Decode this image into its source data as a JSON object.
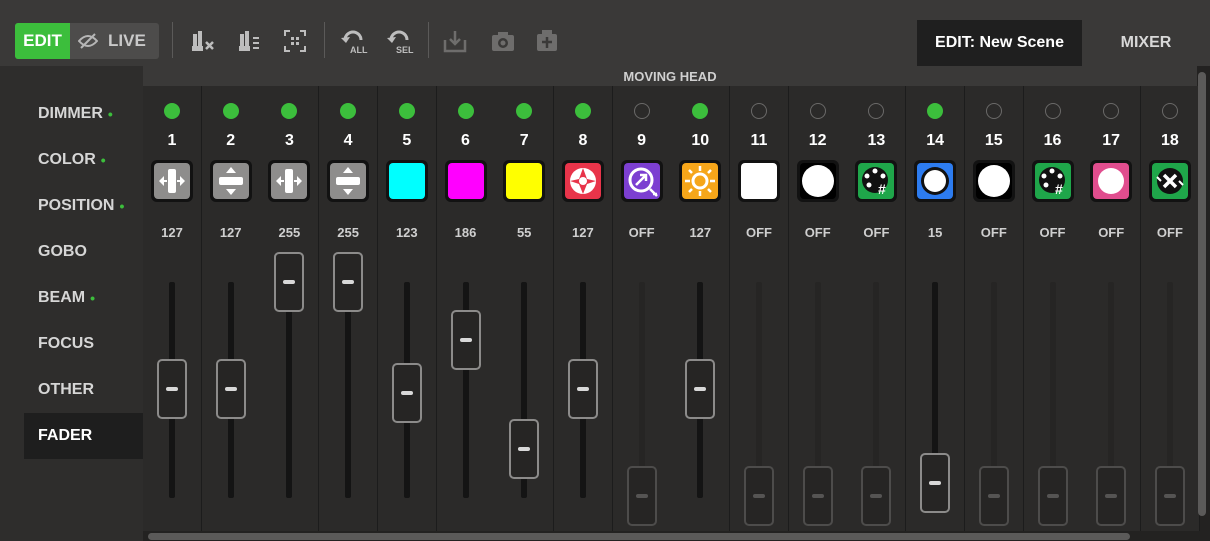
{
  "toolbar": {
    "edit_label": "EDIT",
    "live_label": "LIVE",
    "icons": [
      "clear-selection-icon",
      "highlight-icon",
      "select-group-icon",
      "reset-all-icon",
      "reset-selected-icon",
      "import-icon",
      "snapshot-icon",
      "palette-icon"
    ],
    "reset_all_label": "ALL",
    "reset_sel_label": "SEL"
  },
  "tabs": {
    "edit_scene": "EDIT: New Scene",
    "mixer": "MIXER"
  },
  "sidebar": {
    "items": [
      {
        "label": "DIMMER",
        "dot": "•"
      },
      {
        "label": "COLOR",
        "dot": "•"
      },
      {
        "label": "POSITION",
        "dot": "•"
      },
      {
        "label": "GOBO",
        "dot": ""
      },
      {
        "label": "BEAM",
        "dot": "•"
      },
      {
        "label": "FOCUS",
        "dot": ""
      },
      {
        "label": "OTHER",
        "dot": ""
      },
      {
        "label": "FADER",
        "dot": ""
      }
    ],
    "active": "FADER"
  },
  "group_header": "MOVING HEAD",
  "channels": [
    {
      "num": "1",
      "value": "127",
      "led": "on",
      "level": 0.5,
      "icon": "pan-fine-icon"
    },
    {
      "num": "2",
      "value": "127",
      "led": "on",
      "level": 0.5,
      "icon": "tilt-icon"
    },
    {
      "num": "3",
      "value": "255",
      "led": "on",
      "level": 1.0,
      "icon": "pan-icon"
    },
    {
      "num": "4",
      "value": "255",
      "led": "on",
      "level": 1.0,
      "icon": "tilt-fine-icon"
    },
    {
      "num": "5",
      "value": "123",
      "led": "on",
      "level": 0.48,
      "icon": "cyan-swatch-icon"
    },
    {
      "num": "6",
      "value": "186",
      "led": "on",
      "level": 0.73,
      "icon": "magenta-swatch-icon"
    },
    {
      "num": "7",
      "value": "55",
      "led": "on",
      "level": 0.22,
      "icon": "yellow-swatch-icon"
    },
    {
      "num": "8",
      "value": "127",
      "led": "on",
      "level": 0.5,
      "icon": "shutter-icon"
    },
    {
      "num": "9",
      "value": "OFF",
      "led": "off",
      "level": 0.0,
      "icon": "zoom-icon"
    },
    {
      "num": "10",
      "value": "127",
      "led": "on",
      "level": 0.5,
      "icon": "dimmer-sun-icon"
    },
    {
      "num": "11",
      "value": "OFF",
      "led": "off",
      "level": 0.0,
      "icon": "white-swatch-icon"
    },
    {
      "num": "12",
      "value": "OFF",
      "led": "off",
      "level": 0.0,
      "icon": "white-circle-icon"
    },
    {
      "num": "13",
      "value": "OFF",
      "led": "off",
      "level": 0.0,
      "icon": "gobo-wheel-icon"
    },
    {
      "num": "14",
      "value": "15",
      "led": "on",
      "level": 0.06,
      "icon": "color-wheel-icon"
    },
    {
      "num": "15",
      "value": "OFF",
      "led": "off",
      "level": 0.0,
      "icon": "white-circle-icon"
    },
    {
      "num": "16",
      "value": "OFF",
      "led": "off",
      "level": 0.0,
      "icon": "gobo-wheel-2-icon"
    },
    {
      "num": "17",
      "value": "OFF",
      "led": "off",
      "level": 0.0,
      "icon": "pink-circle-icon"
    },
    {
      "num": "18",
      "value": "OFF",
      "led": "off",
      "level": 0.0,
      "icon": "gobo-rotate-icon"
    }
  ],
  "colors": {
    "accent": "#3cbe3c",
    "cyan": "#00ffff",
    "magenta": "#ff00ff",
    "yellow": "#ffff00",
    "red": "#e8344a",
    "purple": "#7c3fd1",
    "orange": "#f6a61a",
    "green": "#1fa64a",
    "blue": "#2d7cf0",
    "pink": "#e04d8e"
  }
}
